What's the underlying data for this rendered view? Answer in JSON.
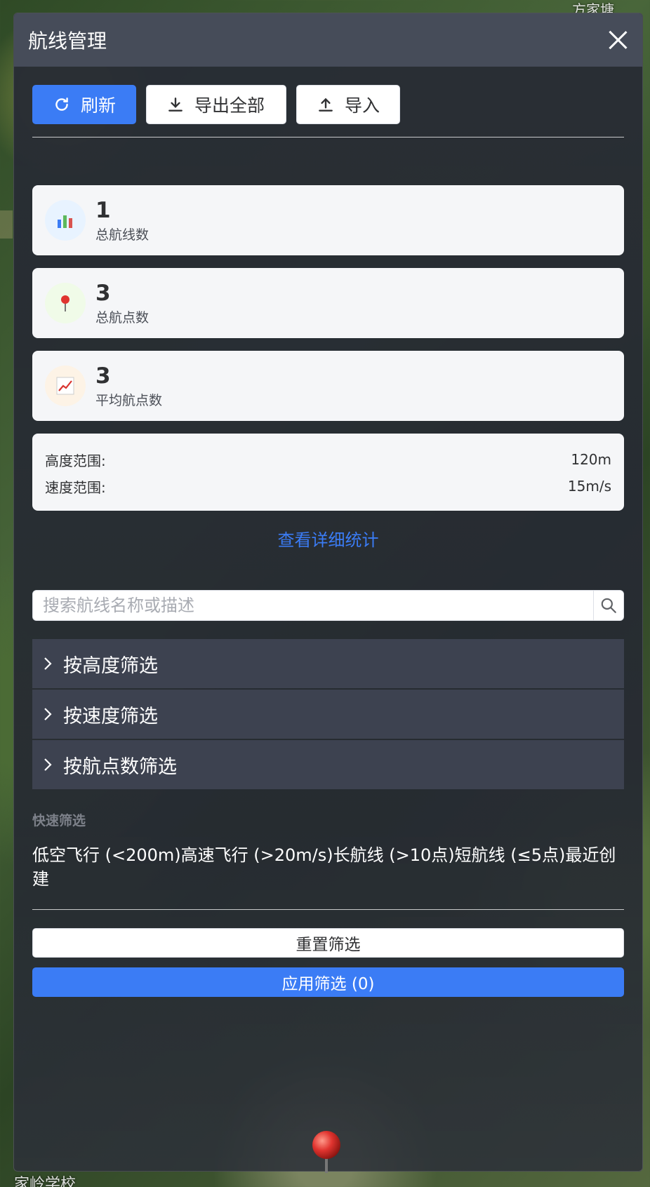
{
  "map": {
    "labels": [
      "方家塘",
      "家岭学校"
    ]
  },
  "panel": {
    "title": "航线管理"
  },
  "toolbar": {
    "refresh_label": "刷新",
    "export_label": "导出全部",
    "import_label": "导入"
  },
  "stats": [
    {
      "value": "1",
      "label": "总航线数",
      "icon": "bar-chart-icon",
      "icon_bg": "#e8f3ff"
    },
    {
      "value": "3",
      "label": "总航点数",
      "icon": "pushpin-icon",
      "icon_bg": "#f0fbe8"
    },
    {
      "value": "3",
      "label": "平均航点数",
      "icon": "trend-chart-icon",
      "icon_bg": "#fdf3e6"
    }
  ],
  "ranges": {
    "height_label": "高度范围:",
    "height_value": "120m",
    "speed_label": "速度范围:",
    "speed_value": "15m/s"
  },
  "detail_link": "查看详细统计",
  "search": {
    "placeholder": "搜索航线名称或描述"
  },
  "filters": [
    {
      "label": "按高度筛选"
    },
    {
      "label": "按速度筛选"
    },
    {
      "label": "按航点数筛选"
    }
  ],
  "quick_filter": {
    "title": "快速筛选",
    "tags": [
      "低空飞行 (<200m)",
      "高速飞行 (>20m/s)",
      "长航线 (>10点)",
      "短航线 (≤5点)",
      "最近创建"
    ]
  },
  "actions": {
    "reset_label": "重置筛选",
    "apply_label": "应用筛选 (0)"
  },
  "colors": {
    "primary": "#3b7cf5",
    "header_bg": "#464c59",
    "collapse_bg": "#3d4250"
  }
}
